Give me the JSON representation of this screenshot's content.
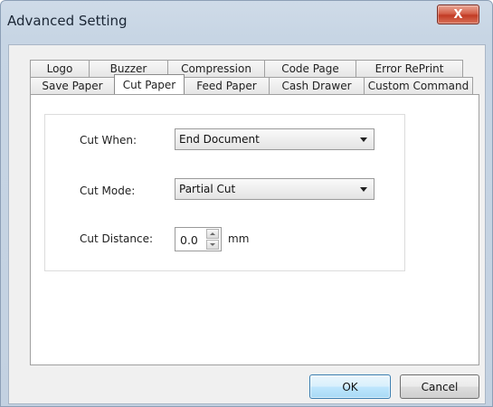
{
  "window": {
    "title": "Advanced Setting",
    "close_symbol": "X"
  },
  "tabs": {
    "back_row": [
      "Logo",
      "Buzzer",
      "Compression",
      "Code Page",
      "Error RePrint"
    ],
    "front_row": [
      "Save Paper",
      "Cut Paper",
      "Feed Paper",
      "Cash Drawer",
      "Custom Command"
    ],
    "selected": "Cut Paper"
  },
  "form": {
    "cut_when": {
      "label": "Cut When:",
      "value": "End Document"
    },
    "cut_mode": {
      "label": "Cut Mode:",
      "value": "Partial Cut"
    },
    "cut_distance": {
      "label": "Cut Distance:",
      "value": "0.0",
      "unit": "mm"
    }
  },
  "buttons": {
    "ok": "OK",
    "cancel": "Cancel"
  },
  "colors": {
    "title_bar": "#c7d5e4",
    "close_button": "#c23b24",
    "ok_button_border": "#3c7fb1"
  }
}
